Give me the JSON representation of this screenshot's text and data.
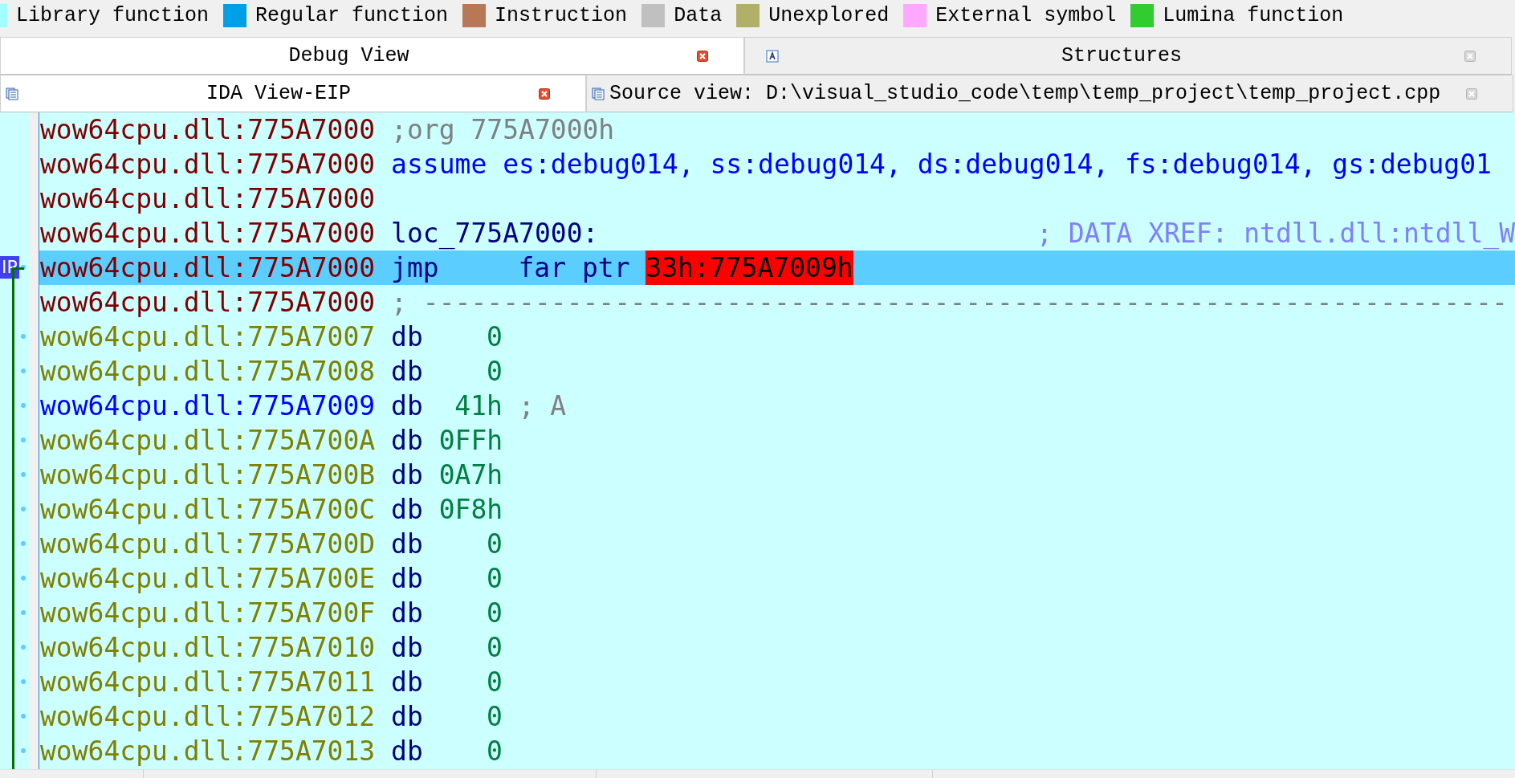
{
  "legend": [
    {
      "label": "Library function",
      "color": "#a0ffff"
    },
    {
      "label": "Regular function",
      "color": "#00a0e8"
    },
    {
      "label": "Instruction",
      "color": "#b87858"
    },
    {
      "label": "Data",
      "color": "#c0c0c0"
    },
    {
      "label": "Unexplored",
      "color": "#b0b068"
    },
    {
      "label": "External symbol",
      "color": "#ffa8ff"
    },
    {
      "label": "Lumina function",
      "color": "#30cc30"
    }
  ],
  "tab_rows": [
    {
      "tabs": [
        {
          "label": "Debug View",
          "selected": true,
          "kind": "plain"
        },
        {
          "label": "Structures",
          "selected": false,
          "kind": "structures"
        }
      ]
    },
    {
      "tabs": [
        {
          "label": "IDA View-EIP",
          "selected": true,
          "kind": "listing"
        },
        {
          "label": "Source view: D:\\visual_studio_code\\temp\\temp_project\\temp_project.cpp",
          "selected": false,
          "kind": "source"
        }
      ]
    }
  ],
  "eip_marker": "IP",
  "lines": [
    {
      "address": "wow64cpu.dll:775A7000",
      "kind": "code",
      "selected": false,
      "tokens": [
        {
          "text": ";org 775A7000h",
          "kind": "directive"
        }
      ]
    },
    {
      "address": "wow64cpu.dll:775A7000",
      "kind": "code",
      "selected": false,
      "tokens": [
        {
          "text": "assume es:debug014, ss:debug014, ds:debug014, fs:debug014, gs:debug01",
          "kind": "keyword"
        }
      ]
    },
    {
      "address": "wow64cpu.dll:775A7000",
      "kind": "code",
      "selected": false
    },
    {
      "address": "wow64cpu.dll:775A7000",
      "kind": "code",
      "selected": false,
      "tokens": [
        {
          "text": "loc_775A7000:",
          "kind": "label"
        },
        {
          "text": "; DATA XREF: ntdll.dll:ntdll_W",
          "kind": "xref"
        }
      ]
    },
    {
      "address": "wow64cpu.dll:775A7000",
      "kind": "code",
      "selected": true,
      "tokens": [
        {
          "text": "jmp",
          "kind": "mnemonic"
        },
        {
          "text": "far ptr",
          "kind": "operand"
        },
        {
          "text": "33h:775A7009h",
          "kind": "target"
        }
      ]
    },
    {
      "address": "wow64cpu.dll:775A7000",
      "kind": "code",
      "selected": false,
      "tokens": [
        {
          "text": "; --------------------------------------------------------------------",
          "kind": "directive"
        }
      ]
    },
    {
      "address": "wow64cpu.dll:775A7007",
      "kind": "data",
      "selected": false,
      "tokens": [
        {
          "text": "db",
          "kind": "db"
        },
        {
          "text": "0",
          "kind": "number"
        }
      ]
    },
    {
      "address": "wow64cpu.dll:775A7008",
      "kind": "data",
      "selected": false,
      "tokens": [
        {
          "text": "db",
          "kind": "db"
        },
        {
          "text": "0",
          "kind": "number"
        }
      ]
    },
    {
      "address": "wow64cpu.dll:775A7009",
      "kind": "named",
      "selected": false,
      "tokens": [
        {
          "text": "db",
          "kind": "db"
        },
        {
          "text": "41h",
          "kind": "number"
        },
        {
          "text": "; A",
          "kind": "directive"
        }
      ]
    },
    {
      "address": "wow64cpu.dll:775A700A",
      "kind": "data",
      "selected": false,
      "tokens": [
        {
          "text": "db",
          "kind": "db"
        },
        {
          "text": "0FFh",
          "kind": "number"
        }
      ]
    },
    {
      "address": "wow64cpu.dll:775A700B",
      "kind": "data",
      "selected": false,
      "tokens": [
        {
          "text": "db",
          "kind": "db"
        },
        {
          "text": "0A7h",
          "kind": "number"
        }
      ]
    },
    {
      "address": "wow64cpu.dll:775A700C",
      "kind": "data",
      "selected": false,
      "tokens": [
        {
          "text": "db",
          "kind": "db"
        },
        {
          "text": "0F8h",
          "kind": "number"
        }
      ]
    },
    {
      "address": "wow64cpu.dll:775A700D",
      "kind": "data",
      "selected": false,
      "tokens": [
        {
          "text": "db",
          "kind": "db"
        },
        {
          "text": "0",
          "kind": "number"
        }
      ]
    },
    {
      "address": "wow64cpu.dll:775A700E",
      "kind": "data",
      "selected": false,
      "tokens": [
        {
          "text": "db",
          "kind": "db"
        },
        {
          "text": "0",
          "kind": "number"
        }
      ]
    },
    {
      "address": "wow64cpu.dll:775A700F",
      "kind": "data",
      "selected": false,
      "tokens": [
        {
          "text": "db",
          "kind": "db"
        },
        {
          "text": "0",
          "kind": "number"
        }
      ]
    },
    {
      "address": "wow64cpu.dll:775A7010",
      "kind": "data",
      "selected": false,
      "tokens": [
        {
          "text": "db",
          "kind": "db"
        },
        {
          "text": "0",
          "kind": "number"
        }
      ]
    },
    {
      "address": "wow64cpu.dll:775A7011",
      "kind": "data",
      "selected": false,
      "tokens": [
        {
          "text": "db",
          "kind": "db"
        },
        {
          "text": "0",
          "kind": "number"
        }
      ]
    },
    {
      "address": "wow64cpu.dll:775A7012",
      "kind": "data",
      "selected": false,
      "tokens": [
        {
          "text": "db",
          "kind": "db"
        },
        {
          "text": "0",
          "kind": "number"
        }
      ]
    },
    {
      "address": "wow64cpu.dll:775A7013",
      "kind": "data",
      "selected": false,
      "tokens": [
        {
          "text": "db",
          "kind": "db"
        },
        {
          "text": "0",
          "kind": "number"
        }
      ]
    }
  ]
}
